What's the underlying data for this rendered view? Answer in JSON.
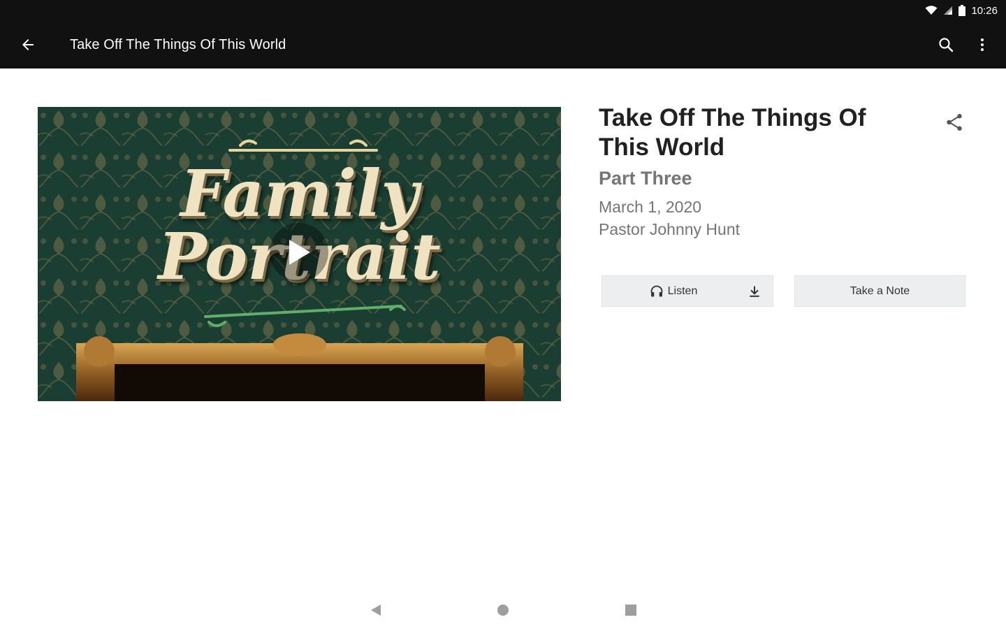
{
  "status_bar": {
    "time": "10:26"
  },
  "app_bar": {
    "title": "Take Off The Things Of This World",
    "back_icon": "arrow-back-icon",
    "search_icon": "search-icon",
    "menu_icon": "more-vert-icon"
  },
  "artwork": {
    "line1": "Family",
    "line2": "Portrait",
    "play_icon": "play-icon"
  },
  "sermon": {
    "title": "Take Off The Things Of This World",
    "part": "Part Three",
    "date": "March 1, 2020",
    "speaker": "Pastor Johnny Hunt"
  },
  "actions": {
    "listen_label": "Listen",
    "note_label": "Take a Note",
    "share_icon": "share-icon",
    "download_icon": "download-icon"
  },
  "colors": {
    "bar_background": "#111111",
    "artwork_green": "#1e3f34",
    "button_background": "#eceeef"
  }
}
